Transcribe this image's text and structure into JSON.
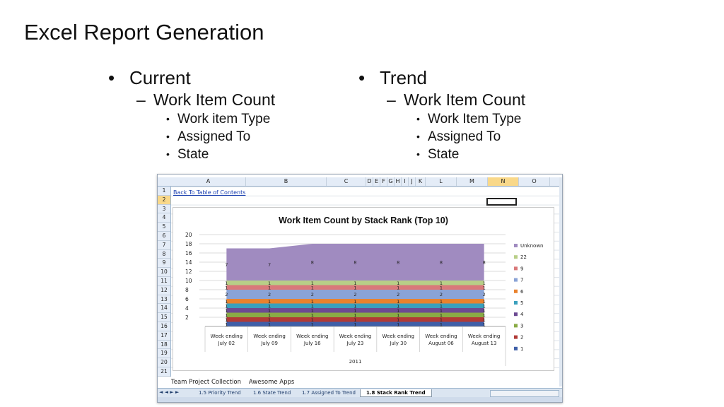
{
  "slide": {
    "title": "Excel Report Generation",
    "left": {
      "heading": "Current",
      "sub": "Work Item Count",
      "items": [
        "Work item Type",
        "Assigned To",
        "State"
      ]
    },
    "right": {
      "heading": "Trend",
      "sub": "Work Item Count",
      "items": [
        "Work Item Type",
        "Assigned To",
        "State"
      ]
    }
  },
  "excel": {
    "columns": [
      "A",
      "B",
      "C",
      "D",
      "E",
      "F",
      "G",
      "H",
      "I",
      "J",
      "K",
      "L",
      "M",
      "N",
      "O"
    ],
    "selected_column": "N",
    "rows": [
      "1",
      "2",
      "3",
      "4",
      "5",
      "6",
      "7",
      "8",
      "9",
      "10",
      "11",
      "12",
      "13",
      "14",
      "15",
      "16",
      "17",
      "18",
      "19",
      "20",
      "21"
    ],
    "selected_row": "2",
    "link_text": "Back To Table of Contents",
    "footer_cell_a": "Team Project Collection",
    "footer_cell_b": "Awesome Apps",
    "sheet_tabs": [
      "1.5 Priority Trend",
      "1.6 State Trend",
      "1.7 Assigned To Trend",
      "1.8 Stack Rank Trend"
    ],
    "active_tab": "1.8 Stack Rank Trend",
    "nav_buttons": "◄ ◄ ► ►",
    "colors": {
      "header_bg": "#e4ecf7",
      "selected_header": "#f9d889",
      "link": "#1a3fb0"
    }
  },
  "chart_data": {
    "type": "area",
    "title": "Work Item Count by Stack Rank (Top 10)",
    "categories": [
      "Week ending July 02",
      "Week ending July 09",
      "Week ending July 16",
      "Week ending July 23",
      "Week ending July 30",
      "Week ending August 06",
      "Week ending August 13"
    ],
    "category_lines": [
      [
        "Week ending",
        "July 02"
      ],
      [
        "Week ending",
        "July 09"
      ],
      [
        "Week ending",
        "July 16"
      ],
      [
        "Week ending",
        "July 23"
      ],
      [
        "Week ending",
        "July 30"
      ],
      [
        "Week ending",
        "August 06"
      ],
      [
        "Week ending",
        "August 13"
      ]
    ],
    "x_group_label": "2011",
    "ylim": [
      0,
      20
    ],
    "yticks": [
      2,
      4,
      6,
      8,
      10,
      12,
      14,
      16,
      18,
      20
    ],
    "stacked": true,
    "series": [
      {
        "name": "1",
        "color": "#3f5fa8",
        "values": [
          1,
          1,
          1,
          1,
          1,
          1,
          1
        ]
      },
      {
        "name": "2",
        "color": "#b03a36",
        "values": [
          1,
          1,
          1,
          1,
          1,
          1,
          1
        ]
      },
      {
        "name": "3",
        "color": "#8aab45",
        "values": [
          1,
          1,
          1,
          1,
          1,
          1,
          1
        ]
      },
      {
        "name": "4",
        "color": "#6c4a92",
        "values": [
          1,
          1,
          1,
          1,
          1,
          1,
          1
        ]
      },
      {
        "name": "5",
        "color": "#3aa0bd",
        "values": [
          1,
          1,
          1,
          1,
          1,
          1,
          1
        ]
      },
      {
        "name": "6",
        "color": "#e9822d",
        "values": [
          1,
          1,
          1,
          1,
          1,
          1,
          1
        ]
      },
      {
        "name": "7",
        "color": "#8aa3d6",
        "values": [
          2,
          2,
          2,
          2,
          2,
          2,
          2
        ]
      },
      {
        "name": "9",
        "color": "#d9797a",
        "values": [
          1,
          1,
          1,
          1,
          1,
          1,
          1
        ]
      },
      {
        "name": "22",
        "color": "#b8cf87",
        "values": [
          1,
          1,
          1,
          1,
          1,
          1,
          1
        ]
      },
      {
        "name": "Unknown",
        "color": "#a08bc0",
        "values": [
          7,
          7,
          8,
          8,
          8,
          8,
          8
        ]
      }
    ],
    "legend": "right"
  }
}
